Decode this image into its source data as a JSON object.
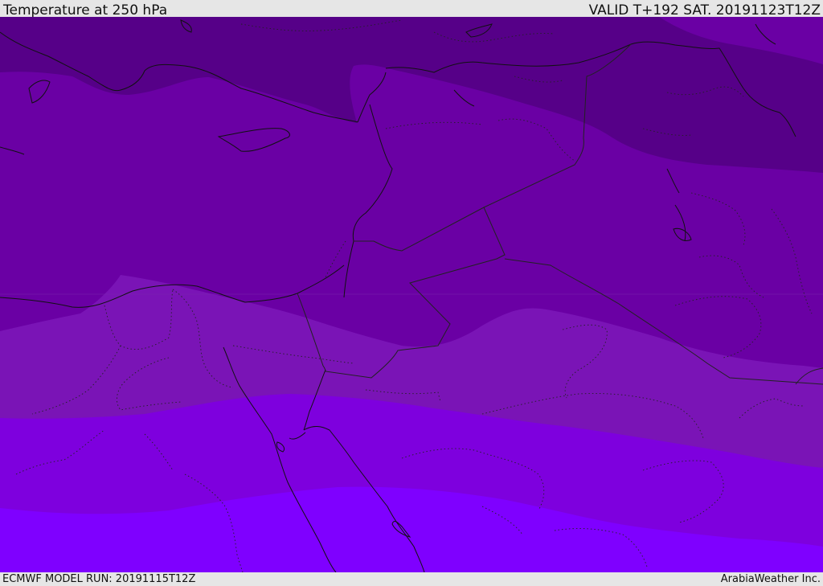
{
  "header": {
    "title": "Temperature at 250 hPa",
    "valid_time": "VALID T+192 SAT. 20191123T12Z"
  },
  "footer": {
    "model_run": "ECMWF MODEL RUN: 20191115T12Z",
    "credit": "ArabiaWeather Inc."
  },
  "map": {
    "colors": {
      "band_coldest": "#560088",
      "band_cold": "#6a00a4",
      "band_mid": "#7a14b6",
      "band_warm": "#7e00de",
      "band_warmest": "#7f00ff",
      "coastline": "#111111",
      "border": "#222222"
    }
  }
}
